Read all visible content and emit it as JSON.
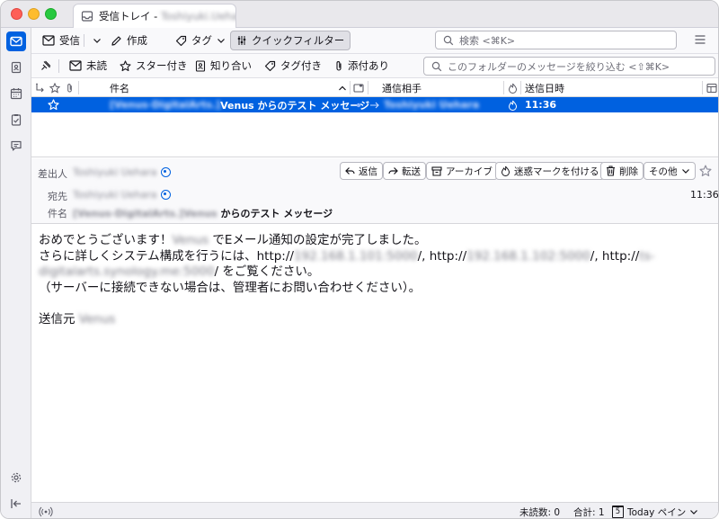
{
  "window": {
    "tab_title_prefix": "受信トレイ - ",
    "tab_title_account": "Toshiyuki.Uehara.bi..."
  },
  "toolbar": {
    "get_messages": "受信",
    "write": "作成",
    "tag": "タグ",
    "quick_filter": "クイックフィルター",
    "search_placeholder": "検索 <⌘K>"
  },
  "filterbar": {
    "unread": "未読",
    "starred": "スター付き",
    "contacts": "知り合い",
    "tagged": "タグ付き",
    "attachment": "添付あり",
    "filter_placeholder": "このフォルダーのメッセージを絞り込む <⇧⌘K>"
  },
  "columns": {
    "subject": "件名",
    "correspondent": "通信相手",
    "date": "送信日時"
  },
  "messages": [
    {
      "subject_tag": "[Venus-DigitalArts.]",
      "subject": " Venus からのテスト メッセージ",
      "correspondent": "Toshiyuki Uehara",
      "date": "11:36"
    }
  ],
  "header": {
    "from_label": "差出人",
    "from_value": "Toshiyuki Uehara",
    "to_label": "宛先",
    "to_value": "Toshiyuki Uehara",
    "subject_label": "件名",
    "subject_tag": "[Venus-DigitalArts.]",
    "subject_name": "Venus",
    "subject_rest": " からのテスト メッセージ",
    "time": "11:36",
    "reply": "返信",
    "forward": "転送",
    "archive": "アーカイブ",
    "junk": "迷惑マークを付ける",
    "delete": "削除",
    "more": "その他"
  },
  "body": {
    "line1_a": "おめでとうございます！",
    "line1_name": "Venus",
    "line1_b": " でEメール通知の設定が完了しました。",
    "line2_a": "さらに詳しくシステム構成を行うには、http://",
    "line2_ip1": "192.168.1.101:5000",
    "line2_b": "/, http://",
    "line2_ip2": "192.168.1.102:5000",
    "line2_c": "/, http://",
    "line2_host_a": "ts-",
    "line3_host_b": "digitalarts.synology.me:5000",
    "line3_a": "/ をご覧ください。",
    "line4": "（サーバーに接続できない場合は、管理者にお問い合わせください）。",
    "sig_a": "送信元 ",
    "sig_name": "Venus"
  },
  "status": {
    "unread": "未読数: 0",
    "total": "合計: 1",
    "today_day": "5",
    "today_pane": "Today ペイン"
  },
  "colors": {
    "accent": "#0061e0",
    "selected_row": "#0061e0"
  }
}
